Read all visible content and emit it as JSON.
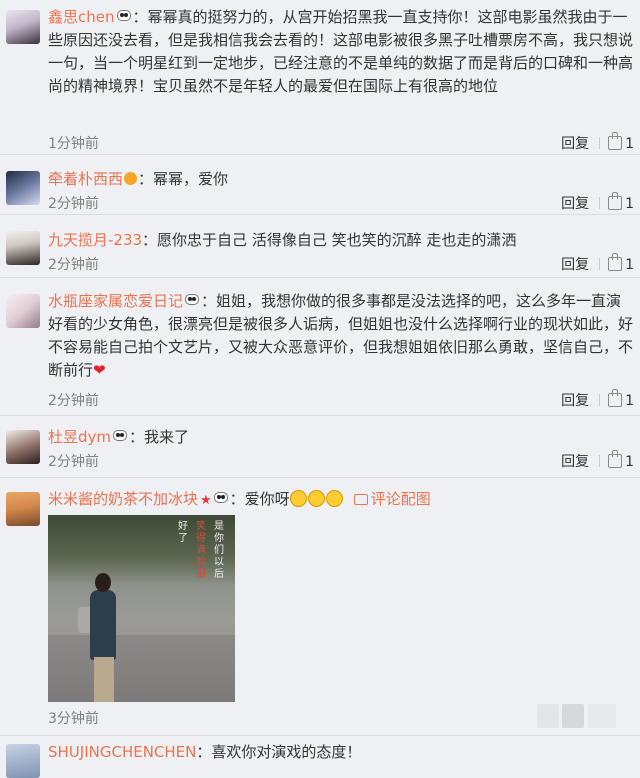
{
  "comments": [
    {
      "username": "鑫思chen",
      "text": "：幂幂真的挺努力的，从宫开始招黑我一直支持你！这部电影虽然我由于一些原因还没去看，但是我相信我会去看的！这部电影被很多黑子吐槽票房不高，我只想说一句，当一个明星红到一定地步，已经注意的不是单纯的数据了而是背后的口碑和一种高尚的精神境界！宝贝虽然不是年轻人的最爱但在国际上有很高的地位",
      "time": "1分钟前",
      "reply": "回复",
      "likes": "1"
    },
    {
      "username": "牵着朴西西",
      "text": "：幂幂，爱你",
      "time": "2分钟前",
      "reply": "回复",
      "likes": "1"
    },
    {
      "username": "九天揽月-233",
      "text": "：愿你忠于自己 活得像自己 笑也笑的沉醉 走也走的潇洒",
      "time": "2分钟前",
      "reply": "回复",
      "likes": "1"
    },
    {
      "username": "水瓶座家属恋爱日记",
      "text": "：姐姐，我想你做的很多事都是没法选择的吧，这么多年一直演好看的少女角色，很漂亮但是被很多人诟病，但姐姐也没什么选择啊行业的现状如此，好不容易能自己拍个文艺片，又被大众恶意评价，但我想姐姐依旧那么勇敢，坚信自己，不断前行",
      "time": "2分钟前",
      "reply": "回复",
      "likes": "1"
    },
    {
      "username": "杜昱dym",
      "text": "：我来了",
      "time": "2分钟前",
      "reply": "回复",
      "likes": "1"
    },
    {
      "username": "米米酱的奶茶不加冰块",
      "text": "：爱你呀",
      "pic_link": "评论配图",
      "time": "3分钟前"
    },
    {
      "username": "SHUJINGCHENCHEN",
      "text": "：喜欢你对演戏的态度！"
    }
  ],
  "poster_text": {
    "col1": "好了",
    "col2": "笑得满脸泪",
    "col3": "是你们以后"
  },
  "colors": {
    "username": "#eb7350",
    "background": "#eef0f3",
    "time": "#808080"
  }
}
